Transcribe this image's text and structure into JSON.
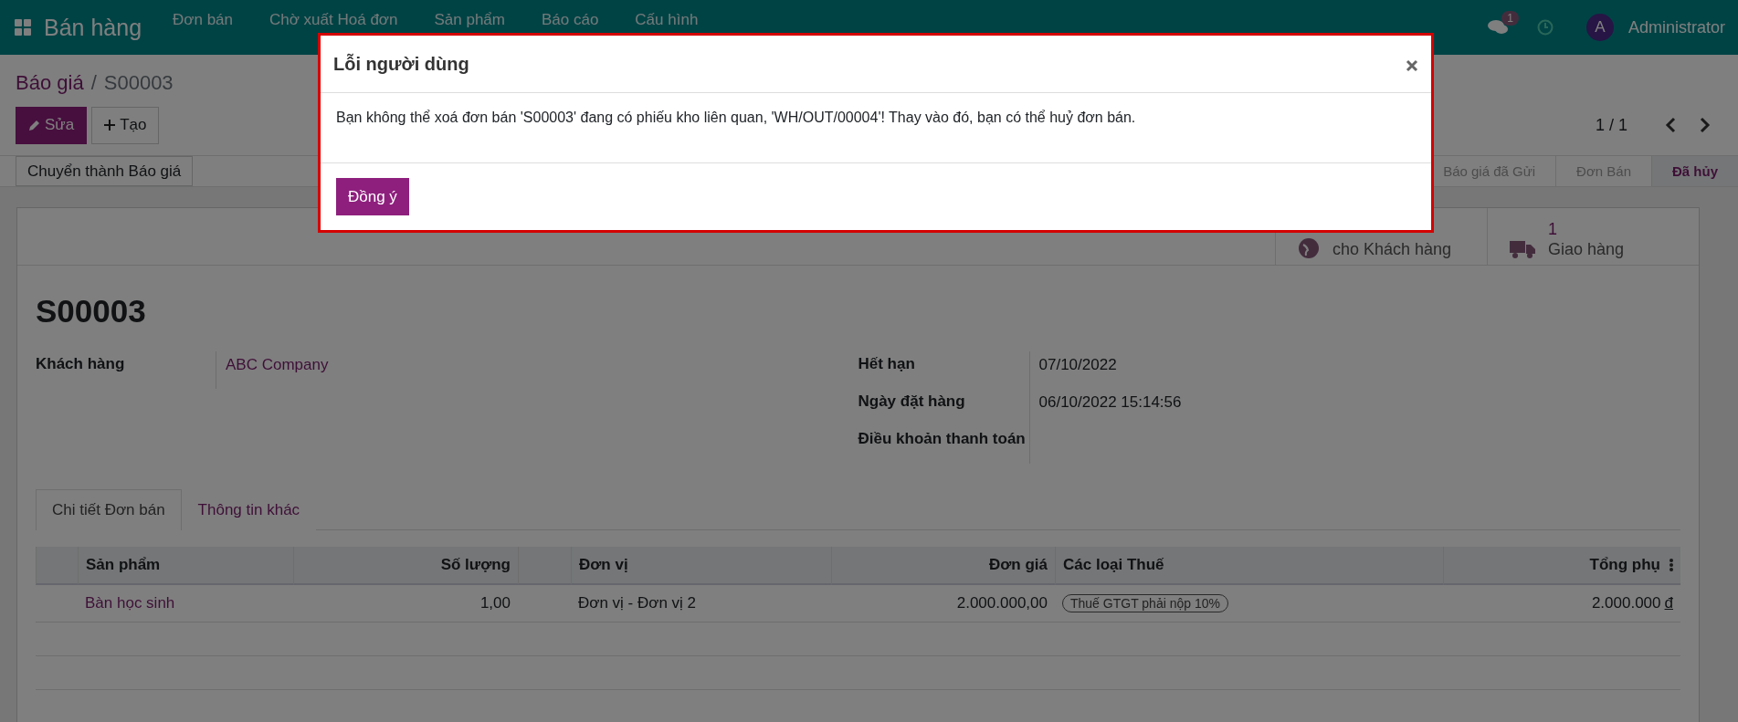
{
  "navbar": {
    "app_name": "Bán hàng",
    "menu": [
      "Đơn bán",
      "Chờ xuất Hoá đơn",
      "Sản phẩm",
      "Báo cáo",
      "Cấu hình"
    ],
    "message_count": "1",
    "user_initial": "A",
    "user_name": "Administrator"
  },
  "breadcrumb": {
    "parent": "Báo giá",
    "separator": "/",
    "current": "S00003"
  },
  "control_buttons": [
    {
      "label": "Sửa",
      "kind": "primary"
    },
    {
      "label": "Tạo",
      "kind": "secondary"
    }
  ],
  "pager": {
    "value": "1 / 1"
  },
  "header_buttons": [
    "Chuyển thành Báo giá"
  ],
  "status_steps": [
    {
      "label": "Báo giá đã Gửi",
      "selected": false
    },
    {
      "label": "Đơn Bán",
      "selected": false
    },
    {
      "label": "Đã hủy",
      "selected": true
    }
  ],
  "smart_buttons": [
    {
      "kind": "globe",
      "label": "cho Khách hàng"
    },
    {
      "kind": "truck",
      "value": "1",
      "label": "Giao hàng"
    }
  ],
  "record": {
    "name": "S00003"
  },
  "fields_left": [
    {
      "label": "Khách hàng",
      "value": "ABC Company",
      "kind": "link"
    }
  ],
  "fields_right": [
    {
      "label": "Hết hạn",
      "value": "07/10/2022"
    },
    {
      "label": "Ngày đặt hàng",
      "value": "06/10/2022 15:14:56"
    },
    {
      "label": "Điều khoản thanh toán"
    }
  ],
  "tabs": [
    {
      "label": "Chi tiết Đơn bán",
      "selected": true
    },
    {
      "label": "Thông tin khác",
      "selected": false
    }
  ],
  "table": {
    "columns": [
      {
        "label": "Sản phẩm",
        "kind": "text"
      },
      {
        "label": "Số lượng",
        "kind": "number"
      },
      {
        "label": "Đơn vị",
        "kind": "text"
      },
      {
        "label": "Đơn giá",
        "kind": "number"
      },
      {
        "label": "Các loại Thuế",
        "kind": "text"
      },
      {
        "label": "Tổng phụ",
        "kind": "number"
      }
    ],
    "rows": [
      {
        "product": "Bàn học sinh",
        "quantity": "1,00",
        "unit": "Đơn vị - Đơn vị 2",
        "price": "2.000.000,00",
        "taxes": [
          "Thuế GTGT phải nộp 10%"
        ],
        "subtotal": "2.000.000",
        "currency": "đ"
      }
    ]
  },
  "dialog": {
    "title": "Lỗi người dùng",
    "message": "Bạn không thể xoá đơn bán 'S00003' đang có phiếu kho liên quan, 'WH/OUT/00004'! Thay vào đó, bạn có thể huỷ đơn bán.",
    "buttons": [
      "Đồng ý"
    ]
  }
}
